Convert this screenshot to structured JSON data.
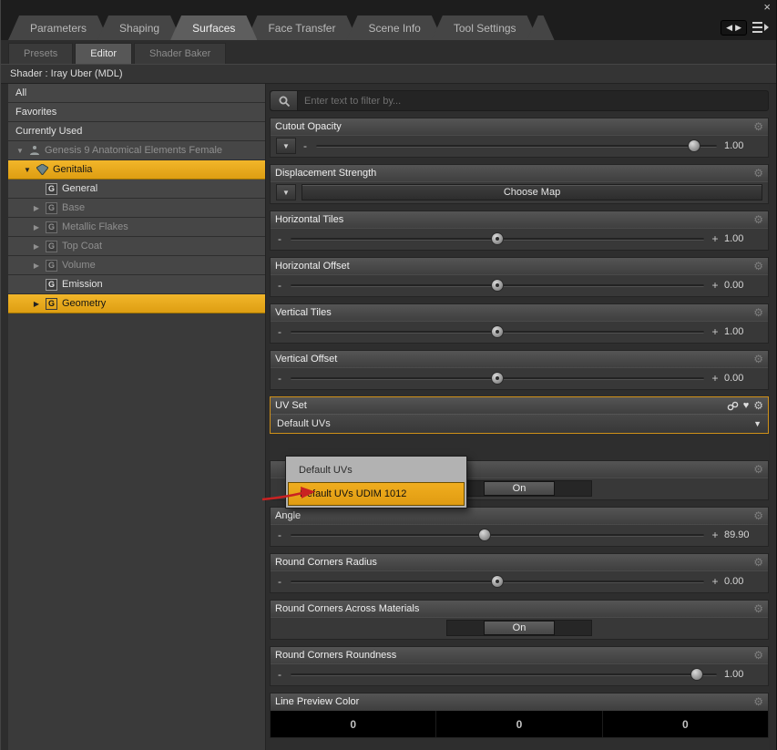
{
  "icons": {
    "close": "×",
    "down": "▼",
    "right": "▶",
    "left": "◀",
    "minus": "-",
    "plus": "+",
    "gear": "⚙",
    "heart": "♥",
    "g_badge": "G"
  },
  "tab_bar": {
    "tabs": [
      {
        "label": "Parameters",
        "active": false
      },
      {
        "label": "Shaping",
        "active": false
      },
      {
        "label": "Surfaces",
        "active": true
      },
      {
        "label": "Face Transfer",
        "active": false
      },
      {
        "label": "Scene Info",
        "active": false
      },
      {
        "label": "Tool Settings",
        "active": false
      }
    ]
  },
  "subtabs": [
    {
      "label": "Presets",
      "active": false
    },
    {
      "label": "Editor",
      "active": true
    },
    {
      "label": "Shader Baker",
      "active": false
    }
  ],
  "shader_label": "Shader : Iray Uber (MDL)",
  "filter": {
    "placeholder": "Enter text to filter by..."
  },
  "tree": {
    "items": [
      {
        "label": "All"
      },
      {
        "label": "Favorites"
      },
      {
        "label": "Currently Used"
      },
      {
        "label": "Genesis 9 Anatomical Elements Female",
        "state": "dim",
        "expanded": true
      },
      {
        "label": "Genitalia",
        "state": "selected",
        "expanded": true
      },
      {
        "label": "General"
      },
      {
        "label": "Base",
        "state": "dim",
        "expanded": false
      },
      {
        "label": "Metallic Flakes",
        "state": "dim",
        "expanded": false
      },
      {
        "label": "Top Coat",
        "state": "dim",
        "expanded": false
      },
      {
        "label": "Volume",
        "state": "dim",
        "expanded": false
      },
      {
        "label": "Emission"
      },
      {
        "label": "Geometry",
        "state": "selected",
        "expanded": false
      }
    ]
  },
  "groups": {
    "cutout_opacity": {
      "label": "Cutout Opacity",
      "value": "1.00"
    },
    "displacement_strength": {
      "label": "Displacement Strength",
      "button_label": "Choose Map"
    },
    "horizontal_tiles": {
      "label": "Horizontal Tiles",
      "value": "1.00"
    },
    "horizontal_offset": {
      "label": "Horizontal Offset",
      "value": "0.00"
    },
    "vertical_tiles": {
      "label": "Vertical Tiles",
      "value": "1.00"
    },
    "vertical_offset": {
      "label": "Vertical Offset",
      "value": "0.00"
    },
    "uv_set": {
      "label": "UV Set",
      "value": "Default UVs"
    },
    "covered_toggle": {
      "toggle": "On"
    },
    "angle": {
      "label": "Angle",
      "value": "89.90"
    },
    "round_corners_radius": {
      "label": "Round Corners Radius",
      "value": "0.00"
    },
    "round_corners_across_materials": {
      "label": "Round Corners Across Materials",
      "toggle": "On"
    },
    "round_corners_roundness": {
      "label": "Round Corners Roundness",
      "value": "1.00"
    },
    "line_preview_color": {
      "label": "Line Preview Color",
      "r": "0",
      "g": "0",
      "b": "0"
    }
  },
  "uv_dropdown": {
    "options": [
      {
        "label": "Default UVs",
        "selected": false
      },
      {
        "label": "Default UVs UDIM 1012",
        "selected": true
      }
    ]
  },
  "colors": {
    "selection_yellow": "#e8a41c",
    "uv_group_border": "#cf9018",
    "annotation_arrow": "#c92222"
  }
}
